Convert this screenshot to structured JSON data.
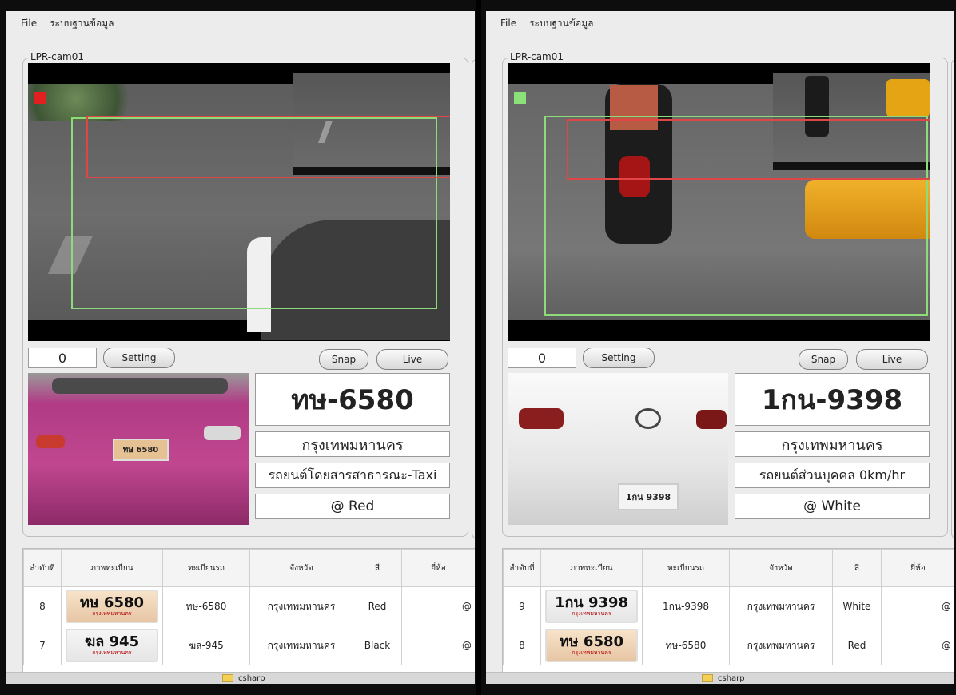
{
  "left": {
    "menu": [
      "File",
      "ระบบฐานข้อมูล"
    ],
    "group_title": "LPR-cam01",
    "counter": "0",
    "buttons": {
      "setting": "Setting",
      "snap": "Snap",
      "live": "Live"
    },
    "status_color": "#e02020",
    "plate_photo_plate": "ทษ 6580",
    "plate_number": "ทษ-6580",
    "province": "กรุงเทพมหานคร",
    "vehicle_type": "รถยนต์โดยสารสาธารณะ-Taxi",
    "vehicle_color": "@ Red",
    "table": {
      "headers": [
        "ลำดับที่",
        "ภาพทะเบียน",
        "ทะเบียนรถ",
        "จังหวัด",
        "สี",
        "ยี่ห้อ"
      ],
      "rows": [
        {
          "no": "8",
          "thumb": "ทษ 6580",
          "thumb_sub": "กรุงเทพมหานคร",
          "plate": "ทษ-6580",
          "province": "กรุงเทพมหานคร",
          "color": "Red",
          "brand": "@"
        },
        {
          "no": "7",
          "thumb": "ฆล 945",
          "thumb_sub": "กรุงเทพมหานคร",
          "plate": "ฆล-945",
          "province": "กรุงเทพมหานคร",
          "color": "Black",
          "brand": "@"
        }
      ]
    },
    "bottom_tab": "csharp"
  },
  "right": {
    "menu": [
      "File",
      "ระบบฐานข้อมูล"
    ],
    "group_title": "LPR-cam01",
    "counter": "0",
    "buttons": {
      "setting": "Setting",
      "snap": "Snap",
      "live": "Live"
    },
    "status_color": "#8be07a",
    "plate_photo_plate": "1กน 9398",
    "plate_number": "1กน-9398",
    "province": "กรุงเทพมหานคร",
    "vehicle_type": "รถยนต์ส่วนบุคคล 0km/hr",
    "vehicle_color": "@ White",
    "table": {
      "headers": [
        "ลำดับที่",
        "ภาพทะเบียน",
        "ทะเบียนรถ",
        "จังหวัด",
        "สี",
        "ยี่ห้อ"
      ],
      "rows": [
        {
          "no": "9",
          "thumb": "1กน 9398",
          "thumb_sub": "กรุงเทพมหานคร",
          "plate": "1กน-9398",
          "province": "กรุงเทพมหานคร",
          "color": "White",
          "brand": "@"
        },
        {
          "no": "8",
          "thumb": "ทษ 6580",
          "thumb_sub": "กรุงเทพมหานคร",
          "plate": "ทษ-6580",
          "province": "กรุงเทพมหานคร",
          "color": "Red",
          "brand": "@"
        }
      ]
    },
    "bottom_tab": "csharp"
  }
}
